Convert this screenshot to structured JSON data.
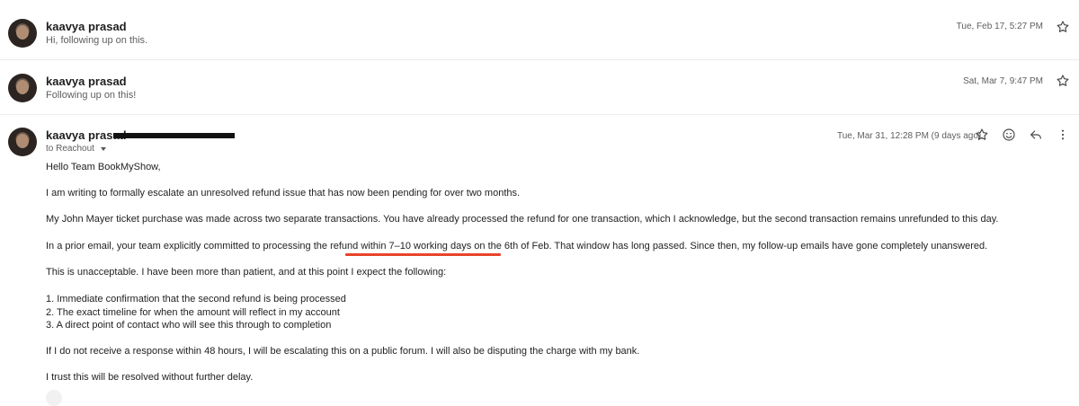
{
  "messages": [
    {
      "sender": "kaavya prasad",
      "snippet": "Hi, following up on this.",
      "date": "Tue, Feb 17, 5:27 PM"
    },
    {
      "sender": "kaavya prasad",
      "snippet": "Following up on this!",
      "date": "Sat, Mar 7, 9:47 PM"
    }
  ],
  "open_message": {
    "sender": "kaavya prasad",
    "to_label": "to Reachout",
    "date": "Tue, Mar 31, 12:28 PM (9 days ago)",
    "body": [
      "Hello Team BookMyShow,",
      "I am writing to formally escalate an unresolved refund issue that has now been pending for over two months.",
      "My John Mayer ticket purchase was made across two separate transactions. You have already processed the refund for one transaction, which I acknowledge, but the second transaction remains unrefunded to this day.",
      "In a prior email, your team explicitly committed to processing the refund within 7–10 working days on the 6th of Feb. That window has long passed. Since then, my follow-up emails have gone completely unanswered.",
      "This is unacceptable. I have been more than patient, and at this point I expect the following:",
      "1. Immediate confirmation that the second refund is being processed",
      "2. The exact timeline for when the amount will reflect in my account",
      "3. A direct point of contact who will see this through to completion",
      "If I do not receive a response within 48 hours, I will be escalating this on a public forum. I will also be disputing the charge with my bank.",
      "I trust this will be resolved without further delay."
    ]
  },
  "icons": [
    "star-icon",
    "emoji-icon",
    "reply-icon",
    "more-vert-icon",
    "dropdown-arrow-icon"
  ],
  "colors": {
    "underline": "#e8442a",
    "redaction": "#111111"
  }
}
